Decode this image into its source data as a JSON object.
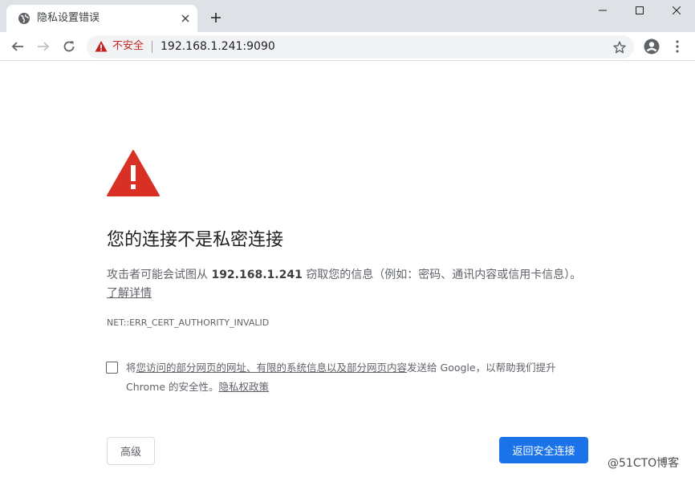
{
  "tab": {
    "title": "隐私设置错误",
    "close": "×",
    "new_tab": "+"
  },
  "toolbar": {
    "insecure_label": "不安全",
    "url": "192.168.1.241:9090"
  },
  "page": {
    "heading": "您的连接不是私密连接",
    "explain_prefix": "攻击者可能会试图从 ",
    "explain_host": "192.168.1.241",
    "explain_suffix": " 窃取您的信息（例如：密码、通讯内容或信用卡信息）。",
    "learn_more": "了解详情",
    "error_code": "NET::ERR_CERT_AUTHORITY_INVALID",
    "optin_prefix": "将",
    "optin_link": "您访问的部分网页的网址、有限的系统信息以及部分网页内容",
    "optin_suffix": "发送给 Google，以帮助我们提升 Chrome 的安全性。",
    "privacy_policy": "隐私权政策",
    "advanced_button": "高级",
    "back_button": "返回安全连接"
  },
  "watermark": "@51CTO博客",
  "colors": {
    "accent": "#1a73e8",
    "danger": "#d93025",
    "insecure": "#c5221f"
  }
}
